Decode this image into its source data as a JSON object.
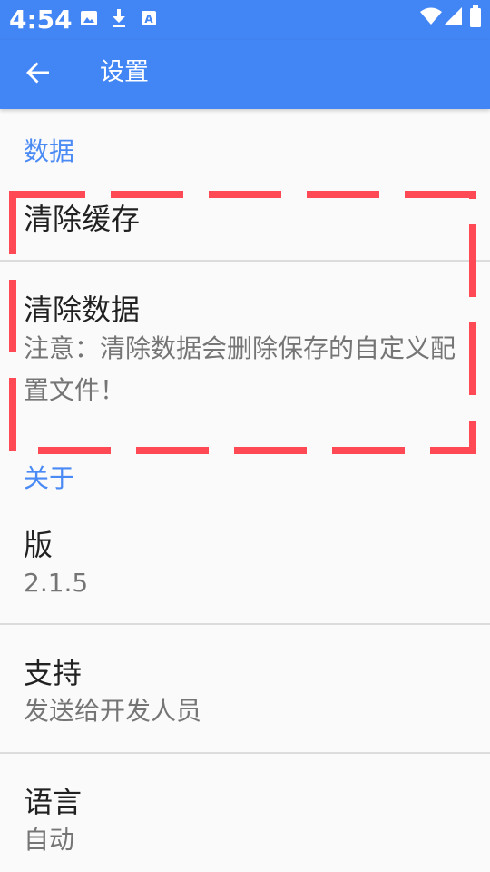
{
  "status_bar": {
    "time": "4:54",
    "left_icons": [
      "image-icon",
      "download-icon",
      "font-a-icon"
    ],
    "right_icons": [
      "wifi-icon",
      "cell-signal-icon",
      "battery-icon"
    ]
  },
  "app_bar": {
    "back_icon": "arrow-left-icon",
    "title": "设置"
  },
  "sections": {
    "data": {
      "header": "数据",
      "clear_cache": {
        "title": "清除缓存"
      },
      "clear_data": {
        "title": "清除数据",
        "summary": "注意：清除数据会删除保存的自定义配置文件！"
      }
    },
    "about": {
      "header": "关于",
      "version": {
        "title": "版",
        "summary": "2.1.5"
      },
      "support": {
        "title": "支持",
        "summary": "发送给开发人员"
      },
      "language": {
        "title": "语言",
        "summary": "自动"
      }
    }
  },
  "colors": {
    "primary": "#4285f4",
    "accent_text": "#4a8af4",
    "title_text": "#212121",
    "summary_text": "#757575",
    "highlight": "#ff4a55"
  }
}
